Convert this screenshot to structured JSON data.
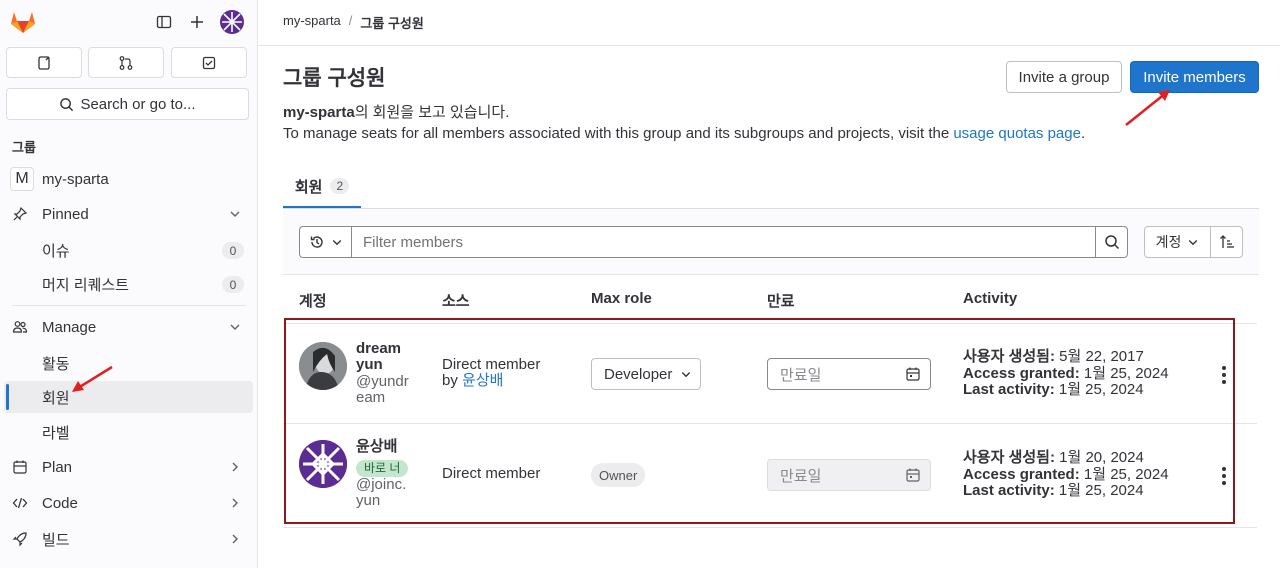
{
  "sidebar": {
    "search_label": "Search or go to...",
    "section_label": "그룹",
    "group_initial": "M",
    "group_name": "my-sparta",
    "pinned_label": "Pinned",
    "items": [
      {
        "label": "이슈",
        "count": "0"
      },
      {
        "label": "머지 리퀘스트",
        "count": "0"
      }
    ],
    "manage_label": "Manage",
    "manage_items": [
      "활동",
      "회원",
      "라벨"
    ],
    "plan_label": "Plan",
    "code_label": "Code",
    "build_label": "빌드"
  },
  "breadcrumb": {
    "root": "my-sparta",
    "separator": "/",
    "current": "그룹 구성원"
  },
  "page": {
    "title": "그룹 구성원",
    "desc_group": "my-sparta",
    "desc_suffix": "의 회원을 보고 있습니다.",
    "desc_line2_prefix": "To manage seats for all members associated with this group and its subgroups and projects, visit the ",
    "desc_link": "usage quotas page",
    "desc_line2_suffix": ".",
    "invite_group_label": "Invite a group",
    "invite_members_label": "Invite members"
  },
  "tabs": [
    {
      "label": "회원",
      "count": "2"
    }
  ],
  "filter": {
    "placeholder": "Filter members",
    "sort_label": "계정"
  },
  "table": {
    "headers": [
      "계정",
      "소스",
      "Max role",
      "만료",
      "Activity"
    ],
    "rows": [
      {
        "name_line1": "dream",
        "name_line2": "yun",
        "badge": "",
        "username_line1": "@yundr",
        "username_line2": "eam",
        "source_line1": "Direct member",
        "source_by": "by ",
        "source_link": "윤상배",
        "role": "Developer",
        "expiry_placeholder": "만료일",
        "created_label": "사용자 생성됨:",
        "created_value": " 5월 22, 2017",
        "granted_label": "Access granted:",
        "granted_value": " 1월 25, 2024",
        "last_label": "Last activity:",
        "last_value": " 1월 25, 2024"
      },
      {
        "name_line1": "윤상배",
        "badge": "바로 너",
        "username_line1": "@joinc.",
        "username_line2": "yun",
        "source_line1": "Direct member",
        "role": "Owner",
        "expiry_placeholder": "만료일",
        "created_label": "사용자 생성됨:",
        "created_value": " 1월 20, 2024",
        "granted_label": "Access granted:",
        "granted_value": " 1월 25, 2024",
        "last_label": "Last activity:",
        "last_value": " 1월 25, 2024"
      }
    ]
  },
  "colors": {
    "accent": "#1f75cb",
    "annotation": "#e02020",
    "badge_bg": "#c3e6cd",
    "badge_text": "#24663b"
  }
}
